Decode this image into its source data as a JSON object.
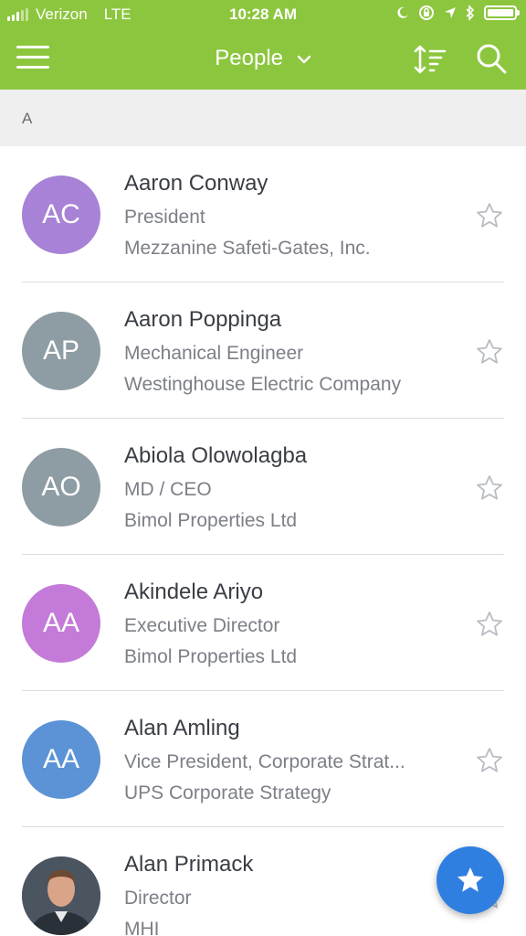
{
  "status": {
    "carrier": "Verizon",
    "network": "LTE",
    "time": "10:28 AM"
  },
  "nav": {
    "title": "People",
    "menu_icon": "hamburger-menu-icon",
    "sort_icon": "sort-icon",
    "search_icon": "search-icon"
  },
  "section": {
    "letter": "A"
  },
  "people": [
    {
      "initials": "AC",
      "name": "Aaron Conway",
      "title": "President",
      "company": "Mezzanine Safeti-Gates, Inc.",
      "color": "#a782d6"
    },
    {
      "initials": "AP",
      "name": "Aaron Poppinga",
      "title": "Mechanical Engineer",
      "company": "Westinghouse Electric Company",
      "color": "#8e9ca3"
    },
    {
      "initials": "AO",
      "name": "Abiola Olowolagba",
      "title": "MD / CEO",
      "company": "Bimol Properties Ltd",
      "color": "#8e9ca3"
    },
    {
      "initials": "AA",
      "name": "Akindele Ariyo",
      "title": "Executive Director",
      "company": "Bimol Properties Ltd",
      "color": "#c47ad8"
    },
    {
      "initials": "AA",
      "name": "Alan Amling",
      "title": "Vice President, Corporate Strat...",
      "company": "UPS Corporate Strategy",
      "color": "#5b93d6"
    },
    {
      "initials": "",
      "name": "Alan Primack",
      "title": "Director",
      "company": "MHI",
      "color": "#3b4a55"
    }
  ],
  "colors": {
    "accent": "#8cc63e",
    "fab": "#2f7fe0"
  }
}
